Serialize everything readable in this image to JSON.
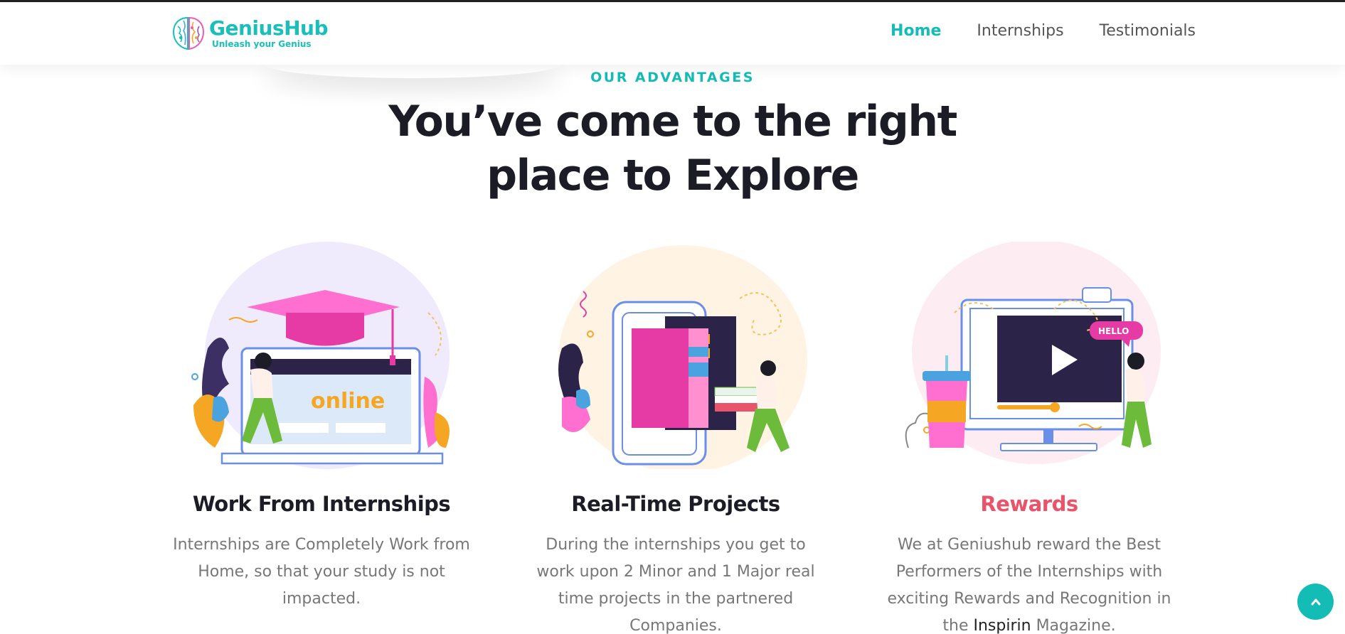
{
  "brand": {
    "name": "GeniusHub",
    "tagline": "Unleash your Genius",
    "accent": "#13bdb6",
    "reward_accent": "#e9546b"
  },
  "nav": {
    "items": [
      {
        "label": "Home",
        "active": true
      },
      {
        "label": "Internships",
        "active": false
      },
      {
        "label": "Testimonials",
        "active": false
      }
    ]
  },
  "section": {
    "eyebrow": "OUR ADVANTAGES",
    "headline_line1": "You’ve come to the right",
    "headline_line2": "place to Explore"
  },
  "cards": [
    {
      "title": "Work From Internships",
      "text": "Internships are Completely Work from Home, so that your study is not impacted.",
      "illustration_text": "online",
      "icon": "graduation-laptop-illustration"
    },
    {
      "title": "Real-Time Projects",
      "text": "During the internships you get to work upon 2 Minor and 1 Major real time projects in the partnered Companies.",
      "icon": "books-phone-illustration"
    },
    {
      "title": "Rewards",
      "text_before": "We at Geniushub reward the Best Performers of the Internships with exciting Rewards and Recognition in the",
      "text_highlight": "Inspirin",
      "text_after": "Magazine.",
      "illustration_text": "HELLO",
      "icon": "video-monitor-illustration"
    }
  ],
  "scroll_top": {
    "icon": "chevron-up-icon"
  }
}
